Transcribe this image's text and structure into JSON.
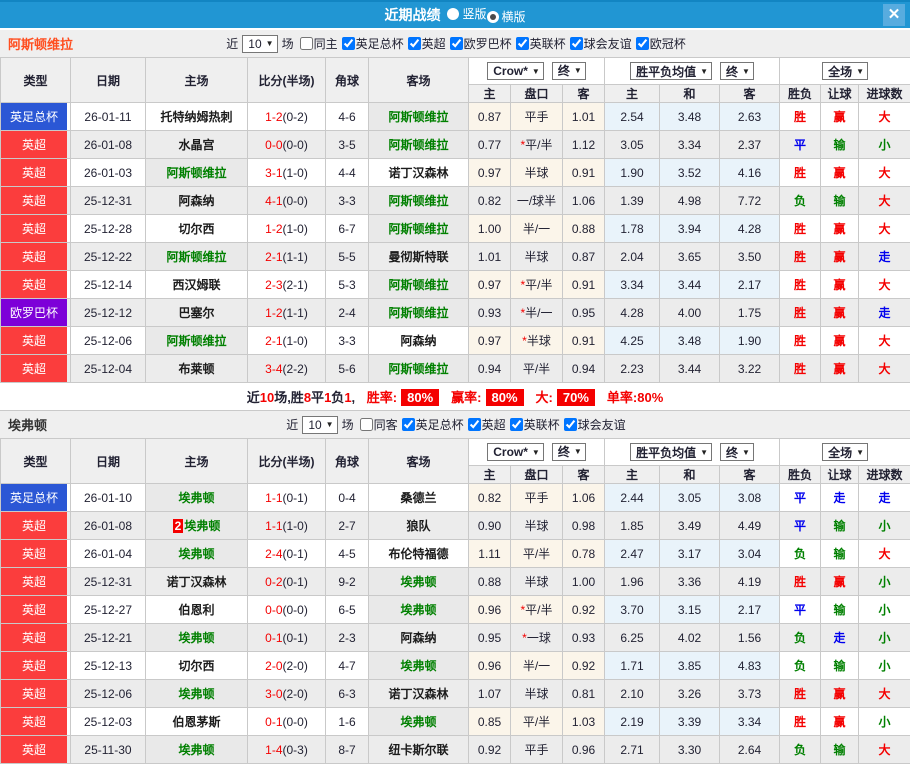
{
  "titlebar": {
    "title": "近期战绩",
    "radios": [
      {
        "label": "竖版",
        "selected": false
      },
      {
        "label": "横版",
        "selected": true
      }
    ],
    "close_label": "✕"
  },
  "table_header": {
    "main": [
      "类型",
      "日期",
      "主场",
      "比分(半场)",
      "角球",
      "客场"
    ],
    "odds_group": {
      "sel1": "Crow*",
      "sel2": "终",
      "cols": [
        "主",
        "盘口",
        "客"
      ]
    },
    "avg_group": {
      "sel1": "胜平负均值",
      "sel2": "终",
      "cols": [
        "主",
        "和",
        "客"
      ]
    },
    "result_group": {
      "sel": "全场",
      "cols": [
        "胜负",
        "让球",
        "进球数"
      ]
    }
  },
  "colors": {
    "titlebar_bg": "#2196d3",
    "comp": {
      "英足总杯": "#2b57d5",
      "英超": "#fb3d3d",
      "欧罗巴杯": "#7d00d8"
    },
    "result": {
      "胜": "#f40000",
      "赢": "#f40000",
      "大": "#f40000",
      "平": "#0000ee",
      "走": "#0000ee",
      "负": "#008000",
      "输": "#008000",
      "小": "#008000"
    },
    "team_accent": {
      "阿斯顿维拉": "#ff4e20",
      "埃弗顿": "#333333"
    }
  },
  "sections": [
    {
      "team": "阿斯顿维拉",
      "filters": {
        "recent_label": "近",
        "recent_value": "10",
        "games_label": "场",
        "same": {
          "label": "同主",
          "checked": false
        },
        "leagues": [
          {
            "label": "英足总杯",
            "checked": true
          },
          {
            "label": "英超",
            "checked": true
          },
          {
            "label": "欧罗巴杯",
            "checked": true
          },
          {
            "label": "英联杯",
            "checked": true
          },
          {
            "label": "球会友谊",
            "checked": true
          },
          {
            "label": "欧冠杯",
            "checked": true
          }
        ]
      },
      "rows": [
        {
          "c": "英足总杯",
          "d": "26-01-11",
          "h": "托特纳姆热刺",
          "ht": false,
          "hb": "",
          "ft": "1-2",
          "hs": "(0-2)",
          "cr": "4-6",
          "aw": "阿斯顿维拉",
          "at": true,
          "o": [
            "0.87",
            "平手",
            "1.01"
          ],
          "a": [
            "2.54",
            "3.48",
            "2.63"
          ],
          "r": [
            "胜",
            "赢",
            "大"
          ]
        },
        {
          "c": "英超",
          "d": "26-01-08",
          "h": "水晶宫",
          "ht": false,
          "hb": "",
          "ft": "0-0",
          "hs": "(0-0)",
          "cr": "3-5",
          "aw": "阿斯顿维拉",
          "at": true,
          "o": [
            "0.77",
            "*平/半",
            "1.12"
          ],
          "a": [
            "3.05",
            "3.34",
            "2.37"
          ],
          "r": [
            "平",
            "输",
            "小"
          ]
        },
        {
          "c": "英超",
          "d": "26-01-03",
          "h": "阿斯顿维拉",
          "ht": true,
          "hb": "",
          "ft": "3-1",
          "hs": "(1-0)",
          "cr": "4-4",
          "aw": "诺丁汉森林",
          "at": false,
          "o": [
            "0.97",
            "半球",
            "0.91"
          ],
          "a": [
            "1.90",
            "3.52",
            "4.16"
          ],
          "r": [
            "胜",
            "赢",
            "大"
          ]
        },
        {
          "c": "英超",
          "d": "25-12-31",
          "h": "阿森纳",
          "ht": false,
          "hb": "",
          "ft": "4-1",
          "hs": "(0-0)",
          "cr": "3-3",
          "aw": "阿斯顿维拉",
          "at": true,
          "o": [
            "0.82",
            "一/球半",
            "1.06"
          ],
          "a": [
            "1.39",
            "4.98",
            "7.72"
          ],
          "r": [
            "负",
            "输",
            "大"
          ]
        },
        {
          "c": "英超",
          "d": "25-12-28",
          "h": "切尔西",
          "ht": false,
          "hb": "",
          "ft": "1-2",
          "hs": "(1-0)",
          "cr": "6-7",
          "aw": "阿斯顿维拉",
          "at": true,
          "o": [
            "1.00",
            "半/一",
            "0.88"
          ],
          "a": [
            "1.78",
            "3.94",
            "4.28"
          ],
          "r": [
            "胜",
            "赢",
            "大"
          ]
        },
        {
          "c": "英超",
          "d": "25-12-22",
          "h": "阿斯顿维拉",
          "ht": true,
          "hb": "",
          "ft": "2-1",
          "hs": "(1-1)",
          "cr": "5-5",
          "aw": "曼彻斯特联",
          "at": false,
          "o": [
            "1.01",
            "半球",
            "0.87"
          ],
          "a": [
            "2.04",
            "3.65",
            "3.50"
          ],
          "r": [
            "胜",
            "赢",
            "走"
          ]
        },
        {
          "c": "英超",
          "d": "25-12-14",
          "h": "西汉姆联",
          "ht": false,
          "hb": "",
          "ft": "2-3",
          "hs": "(2-1)",
          "cr": "5-3",
          "aw": "阿斯顿维拉",
          "at": true,
          "o": [
            "0.97",
            "*平/半",
            "0.91"
          ],
          "a": [
            "3.34",
            "3.44",
            "2.17"
          ],
          "r": [
            "胜",
            "赢",
            "大"
          ]
        },
        {
          "c": "欧罗巴杯",
          "d": "25-12-12",
          "h": "巴塞尔",
          "ht": false,
          "hb": "",
          "ft": "1-2",
          "hs": "(1-1)",
          "cr": "2-4",
          "aw": "阿斯顿维拉",
          "at": true,
          "o": [
            "0.93",
            "*半/一",
            "0.95"
          ],
          "a": [
            "4.28",
            "4.00",
            "1.75"
          ],
          "r": [
            "胜",
            "赢",
            "走"
          ]
        },
        {
          "c": "英超",
          "d": "25-12-06",
          "h": "阿斯顿维拉",
          "ht": true,
          "hb": "",
          "ft": "2-1",
          "hs": "(1-0)",
          "cr": "3-3",
          "aw": "阿森纳",
          "at": false,
          "o": [
            "0.97",
            "*半球",
            "0.91"
          ],
          "a": [
            "4.25",
            "3.48",
            "1.90"
          ],
          "r": [
            "胜",
            "赢",
            "大"
          ]
        },
        {
          "c": "英超",
          "d": "25-12-04",
          "h": "布莱顿",
          "ht": false,
          "hb": "",
          "ft": "3-4",
          "hs": "(2-2)",
          "cr": "5-6",
          "aw": "阿斯顿维拉",
          "at": true,
          "o": [
            "0.94",
            "平/半",
            "0.94"
          ],
          "a": [
            "2.23",
            "3.44",
            "3.22"
          ],
          "r": [
            "胜",
            "赢",
            "大"
          ]
        }
      ],
      "summary": {
        "parts": [
          {
            "t": "近"
          },
          {
            "t": "10",
            "red": true
          },
          {
            "t": "场,胜"
          },
          {
            "t": "8",
            "red": true
          },
          {
            "t": "平"
          },
          {
            "t": "1",
            "red": true
          },
          {
            "t": "负"
          },
          {
            "t": "1",
            "red": true
          },
          {
            "t": ", "
          }
        ],
        "stats": [
          {
            "label": "胜率:",
            "value": "80%",
            "boxed": true
          },
          {
            "label": "赢率:",
            "value": "80%",
            "boxed": true
          },
          {
            "label": "大:",
            "value": "70%",
            "boxed": true
          },
          {
            "label": "单率:",
            "value": "80%",
            "boxed": false
          }
        ]
      }
    },
    {
      "team": "埃弗顿",
      "filters": {
        "recent_label": "近",
        "recent_value": "10",
        "games_label": "场",
        "same": {
          "label": "同客",
          "checked": false
        },
        "leagues": [
          {
            "label": "英足总杯",
            "checked": true
          },
          {
            "label": "英超",
            "checked": true
          },
          {
            "label": "英联杯",
            "checked": true
          },
          {
            "label": "球会友谊",
            "checked": true
          }
        ]
      },
      "rows": [
        {
          "c": "英足总杯",
          "d": "26-01-10",
          "h": "埃弗顿",
          "ht": true,
          "hb": "",
          "ft": "1-1",
          "hs": "(0-1)",
          "cr": "0-4",
          "aw": "桑德兰",
          "at": false,
          "o": [
            "0.82",
            "平手",
            "1.06"
          ],
          "a": [
            "2.44",
            "3.05",
            "3.08"
          ],
          "r": [
            "平",
            "走",
            "走"
          ]
        },
        {
          "c": "英超",
          "d": "26-01-08",
          "h": "埃弗顿",
          "ht": true,
          "hb": "2",
          "ft": "1-1",
          "hs": "(1-0)",
          "cr": "2-7",
          "aw": "狼队",
          "at": false,
          "o": [
            "0.90",
            "半球",
            "0.98"
          ],
          "a": [
            "1.85",
            "3.49",
            "4.49"
          ],
          "r": [
            "平",
            "输",
            "小"
          ]
        },
        {
          "c": "英超",
          "d": "26-01-04",
          "h": "埃弗顿",
          "ht": true,
          "hb": "",
          "ft": "2-4",
          "hs": "(0-1)",
          "cr": "4-5",
          "aw": "布伦特福德",
          "at": false,
          "o": [
            "1.11",
            "平/半",
            "0.78"
          ],
          "a": [
            "2.47",
            "3.17",
            "3.04"
          ],
          "r": [
            "负",
            "输",
            "大"
          ]
        },
        {
          "c": "英超",
          "d": "25-12-31",
          "h": "诺丁汉森林",
          "ht": false,
          "hb": "",
          "ft": "0-2",
          "hs": "(0-1)",
          "cr": "9-2",
          "aw": "埃弗顿",
          "at": true,
          "o": [
            "0.88",
            "半球",
            "1.00"
          ],
          "a": [
            "1.96",
            "3.36",
            "4.19"
          ],
          "r": [
            "胜",
            "赢",
            "小"
          ]
        },
        {
          "c": "英超",
          "d": "25-12-27",
          "h": "伯恩利",
          "ht": false,
          "hb": "",
          "ft": "0-0",
          "hs": "(0-0)",
          "cr": "6-5",
          "aw": "埃弗顿",
          "at": true,
          "o": [
            "0.96",
            "*平/半",
            "0.92"
          ],
          "a": [
            "3.70",
            "3.15",
            "2.17"
          ],
          "r": [
            "平",
            "输",
            "小"
          ]
        },
        {
          "c": "英超",
          "d": "25-12-21",
          "h": "埃弗顿",
          "ht": true,
          "hb": "",
          "ft": "0-1",
          "hs": "(0-1)",
          "cr": "2-3",
          "aw": "阿森纳",
          "at": false,
          "o": [
            "0.95",
            "*一球",
            "0.93"
          ],
          "a": [
            "6.25",
            "4.02",
            "1.56"
          ],
          "r": [
            "负",
            "走",
            "小"
          ]
        },
        {
          "c": "英超",
          "d": "25-12-13",
          "h": "切尔西",
          "ht": false,
          "hb": "",
          "ft": "2-0",
          "hs": "(2-0)",
          "cr": "4-7",
          "aw": "埃弗顿",
          "at": true,
          "o": [
            "0.96",
            "半/一",
            "0.92"
          ],
          "a": [
            "1.71",
            "3.85",
            "4.83"
          ],
          "r": [
            "负",
            "输",
            "小"
          ]
        },
        {
          "c": "英超",
          "d": "25-12-06",
          "h": "埃弗顿",
          "ht": true,
          "hb": "",
          "ft": "3-0",
          "hs": "(2-0)",
          "cr": "6-3",
          "aw": "诺丁汉森林",
          "at": false,
          "o": [
            "1.07",
            "半球",
            "0.81"
          ],
          "a": [
            "2.10",
            "3.26",
            "3.73"
          ],
          "r": [
            "胜",
            "赢",
            "大"
          ]
        },
        {
          "c": "英超",
          "d": "25-12-03",
          "h": "伯恩茅斯",
          "ht": false,
          "hb": "",
          "ft": "0-1",
          "hs": "(0-0)",
          "cr": "1-6",
          "aw": "埃弗顿",
          "at": true,
          "o": [
            "0.85",
            "平/半",
            "1.03"
          ],
          "a": [
            "2.19",
            "3.39",
            "3.34"
          ],
          "r": [
            "胜",
            "赢",
            "小"
          ]
        },
        {
          "c": "英超",
          "d": "25-11-30",
          "h": "埃弗顿",
          "ht": true,
          "hb": "",
          "ft": "1-4",
          "hs": "(0-3)",
          "cr": "8-7",
          "aw": "纽卡斯尔联",
          "at": false,
          "o": [
            "0.92",
            "平手",
            "0.96"
          ],
          "a": [
            "2.71",
            "3.30",
            "2.64"
          ],
          "r": [
            "负",
            "输",
            "大"
          ]
        }
      ],
      "summary": null
    }
  ]
}
